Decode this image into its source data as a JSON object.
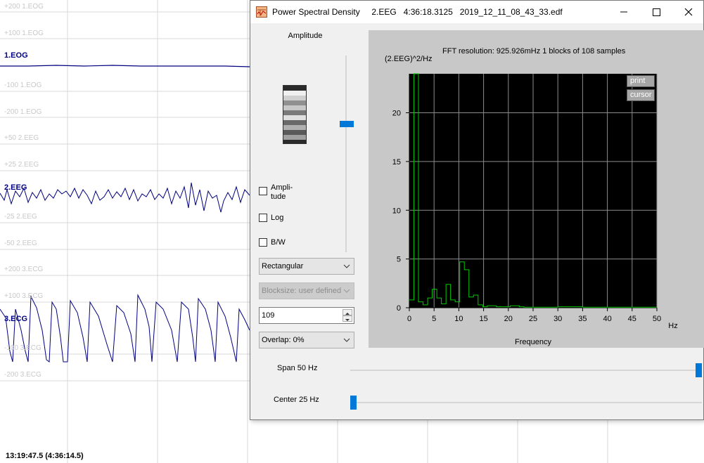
{
  "viewer": {
    "scale_labels": [
      "+200 1.EOG",
      "+100 1.EOG",
      "-100 1.EOG",
      "-200 1.EOG",
      "+50 2.EEG",
      "+25 2.EEG",
      "-25 2.EEG",
      "-50 2.EEG",
      "+200 3.ECG",
      "+100 3.ECG",
      "-100 3.ECG",
      "-200 3.ECG"
    ],
    "channels": [
      "1.EOG",
      "2.EEG",
      "3.ECG"
    ],
    "timestamp": "13:19:47.5 (4:36:14.5)",
    "trace_color": "#000080"
  },
  "window": {
    "title": "Power Spectral Density     2.EEG   4:36:18.3125   2019_12_11_08_43_33.edf",
    "minimize_icon": "minimize-icon",
    "maximize_icon": "maximize-icon",
    "close_icon": "close-icon"
  },
  "controls": {
    "amplitude_label": "Amplitude",
    "amplitude_level": 0.35,
    "checkbox_amplitude": "Ampli-\ntude",
    "checkbox_log": "Log",
    "checkbox_bw": "B/W",
    "window_type": "Rectangular",
    "blocksize": "Blocksize: user defined",
    "blocksize_value": "109",
    "overlap": "Overlap: 0%",
    "span_label": "Span 50 Hz",
    "span_fraction": 1.0,
    "center_label": "Center 25 Hz",
    "center_fraction": 0.0
  },
  "plot": {
    "ylabel": "(2.EEG)^2/Hz",
    "info": "FFT resolution: 925.926mHz   1 blocks of 108 samples",
    "xlabel": "Frequency",
    "unit": "Hz",
    "print_button": "print",
    "cursor_button": "cursor",
    "line_color": "#00c800"
  },
  "chart_data": {
    "type": "line",
    "xlim": [
      0,
      50
    ],
    "ylim": [
      0,
      24
    ],
    "xticks": [
      0,
      5,
      10,
      15,
      20,
      25,
      30,
      35,
      40,
      45,
      50
    ],
    "yticks": [
      0,
      5,
      10,
      15,
      20
    ],
    "x": [
      0,
      0.93,
      1.85,
      2.78,
      3.7,
      4.63,
      5.56,
      6.48,
      7.41,
      8.33,
      9.26,
      10.19,
      11.11,
      12.04,
      12.96,
      13.89,
      14.81,
      15.74,
      16.67,
      17.59,
      18.52,
      19.44,
      20.37,
      21.3,
      22.22,
      23.15,
      24.07,
      25,
      30,
      35,
      40,
      45,
      50
    ],
    "y": [
      0.8,
      30,
      0.6,
      0.3,
      1.0,
      1.9,
      1.0,
      0.4,
      2.4,
      0.8,
      0.6,
      4.7,
      3.9,
      1.1,
      1.3,
      0.3,
      0.1,
      0.2,
      0.2,
      0.1,
      0.1,
      0.1,
      0.2,
      0.2,
      0.1,
      0.05,
      0.05,
      0.05,
      0.1,
      0.05,
      0.05,
      0.05,
      0.05
    ]
  }
}
